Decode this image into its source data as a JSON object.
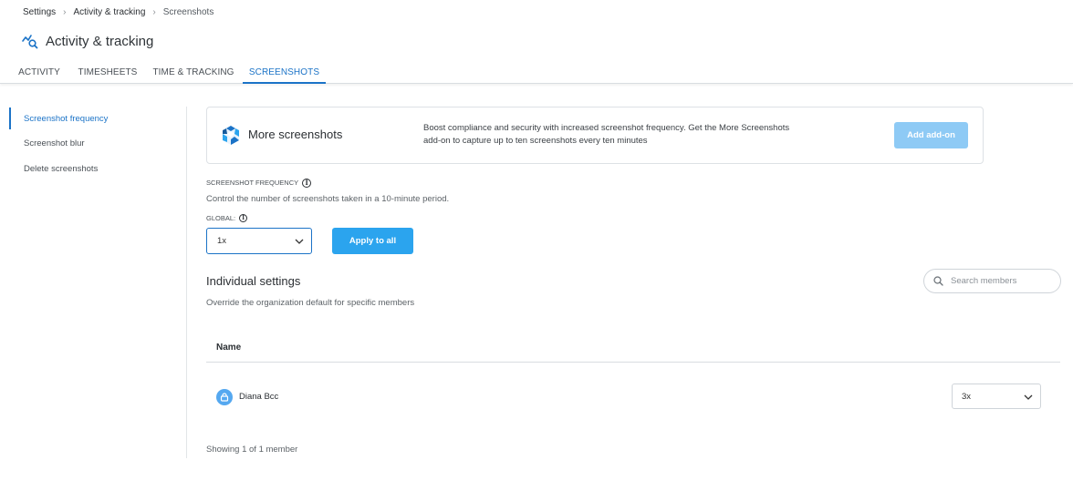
{
  "breadcrumb": {
    "items": [
      "Settings",
      "Activity & tracking",
      "Screenshots"
    ]
  },
  "header": {
    "title": "Activity & tracking",
    "icon": "activity-tracking-icon"
  },
  "tabs": [
    {
      "label": "ACTIVITY",
      "active": false
    },
    {
      "label": "TIMESHEETS",
      "active": false
    },
    {
      "label": "TIME & TRACKING",
      "active": false
    },
    {
      "label": "SCREENSHOTS",
      "active": true
    }
  ],
  "sidebar": {
    "items": [
      {
        "label": "Screenshot frequency",
        "active": true
      },
      {
        "label": "Screenshot blur",
        "active": false
      },
      {
        "label": "Delete screenshots",
        "active": false
      }
    ]
  },
  "promo": {
    "title": "More screenshots",
    "description_line1": "Boost compliance and security with increased screenshot frequency. Get the More Screenshots",
    "description_line2": "add-on to capture up to ten screenshots every ten minutes",
    "button_label": "Add add-on"
  },
  "frequency": {
    "section_label": "SCREENSHOT FREQUENCY",
    "description": "Control the number of screenshots taken in a 10-minute period.",
    "global_label": "GLOBAL:",
    "global_value": "1x",
    "apply_label": "Apply to all"
  },
  "individual": {
    "title": "Individual settings",
    "description": "Override the organization default for specific members",
    "search_placeholder": "Search members",
    "column_name": "Name",
    "members": [
      {
        "name": "Diana Bcc",
        "frequency": "3x"
      }
    ],
    "footer": "Showing 1 of 1 member"
  },
  "colors": {
    "accent": "#1b73c7",
    "primary_button": "#2ba4ee",
    "disabled_button": "#8ecaf5"
  }
}
